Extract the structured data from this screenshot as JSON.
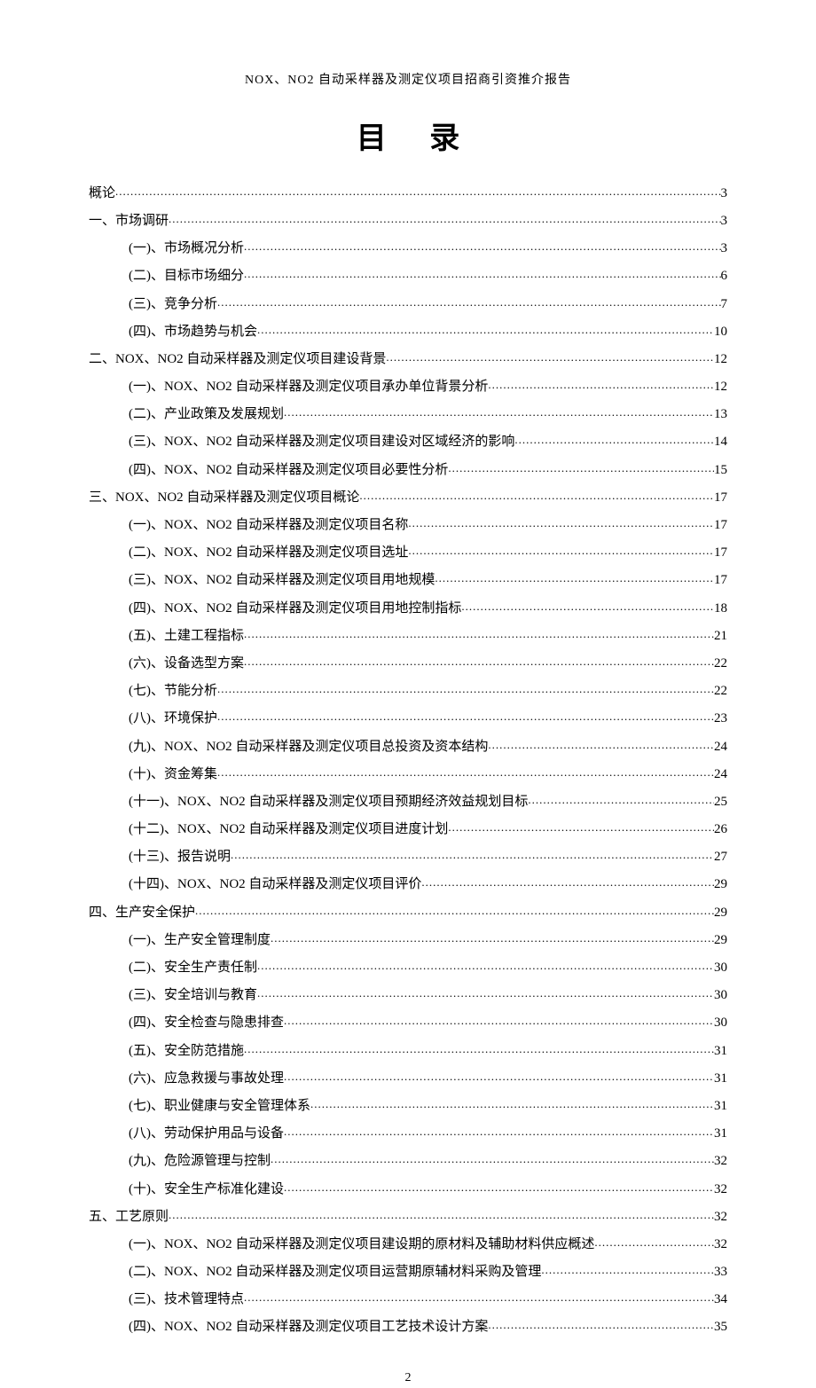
{
  "header": "NOX、NO2 自动采样器及测定仪项目招商引资推介报告",
  "title": "目 录",
  "page_number": "2",
  "toc": [
    {
      "indent": 0,
      "label": "概论",
      "page": "3"
    },
    {
      "indent": 0,
      "label": "一、市场调研",
      "page": "3"
    },
    {
      "indent": 1,
      "label": "(一)、市场概况分析",
      "page": "3"
    },
    {
      "indent": 1,
      "label": "(二)、目标市场细分",
      "page": "6"
    },
    {
      "indent": 1,
      "label": "(三)、竞争分析",
      "page": "7"
    },
    {
      "indent": 1,
      "label": "(四)、市场趋势与机会",
      "page": "10"
    },
    {
      "indent": 0,
      "label": "二、NOX、NO2 自动采样器及测定仪项目建设背景",
      "page": "12"
    },
    {
      "indent": 1,
      "label": "(一)、NOX、NO2 自动采样器及测定仪项目承办单位背景分析",
      "page": "12"
    },
    {
      "indent": 1,
      "label": "(二)、产业政策及发展规划",
      "page": "13"
    },
    {
      "indent": 1,
      "label": "(三)、NOX、NO2 自动采样器及测定仪项目建设对区域经济的影响",
      "page": "14"
    },
    {
      "indent": 1,
      "label": "(四)、NOX、NO2 自动采样器及测定仪项目必要性分析",
      "page": "15"
    },
    {
      "indent": 0,
      "label": "三、NOX、NO2 自动采样器及测定仪项目概论",
      "page": "17"
    },
    {
      "indent": 1,
      "label": "(一)、NOX、NO2 自动采样器及测定仪项目名称",
      "page": "17"
    },
    {
      "indent": 1,
      "label": "(二)、NOX、NO2 自动采样器及测定仪项目选址",
      "page": "17"
    },
    {
      "indent": 1,
      "label": "(三)、NOX、NO2 自动采样器及测定仪项目用地规模",
      "page": "17"
    },
    {
      "indent": 1,
      "label": "(四)、NOX、NO2 自动采样器及测定仪项目用地控制指标",
      "page": "18"
    },
    {
      "indent": 1,
      "label": "(五)、土建工程指标",
      "page": "21"
    },
    {
      "indent": 1,
      "label": "(六)、设备选型方案",
      "page": "22"
    },
    {
      "indent": 1,
      "label": "(七)、节能分析",
      "page": "22"
    },
    {
      "indent": 1,
      "label": "(八)、环境保护",
      "page": "23"
    },
    {
      "indent": 1,
      "label": "(九)、NOX、NO2 自动采样器及测定仪项目总投资及资本结构",
      "page": "24"
    },
    {
      "indent": 1,
      "label": "(十)、资金筹集",
      "page": "24"
    },
    {
      "indent": 1,
      "label": "(十一)、NOX、NO2 自动采样器及测定仪项目预期经济效益规划目标",
      "page": "25"
    },
    {
      "indent": 1,
      "label": "(十二)、NOX、NO2 自动采样器及测定仪项目进度计划",
      "page": "26"
    },
    {
      "indent": 1,
      "label": "(十三)、报告说明",
      "page": "27"
    },
    {
      "indent": 1,
      "label": "(十四)、NOX、NO2 自动采样器及测定仪项目评价",
      "page": "29"
    },
    {
      "indent": 0,
      "label": "四、生产安全保护",
      "page": "29"
    },
    {
      "indent": 1,
      "label": "(一)、生产安全管理制度",
      "page": "29"
    },
    {
      "indent": 1,
      "label": "(二)、安全生产责任制",
      "page": "30"
    },
    {
      "indent": 1,
      "label": "(三)、安全培训与教育",
      "page": "30"
    },
    {
      "indent": 1,
      "label": "(四)、安全检查与隐患排查",
      "page": "30"
    },
    {
      "indent": 1,
      "label": "(五)、安全防范措施",
      "page": "31"
    },
    {
      "indent": 1,
      "label": "(六)、应急救援与事故处理",
      "page": "31"
    },
    {
      "indent": 1,
      "label": "(七)、职业健康与安全管理体系",
      "page": "31"
    },
    {
      "indent": 1,
      "label": "(八)、劳动保护用品与设备",
      "page": "31"
    },
    {
      "indent": 1,
      "label": "(九)、危险源管理与控制",
      "page": "32"
    },
    {
      "indent": 1,
      "label": "(十)、安全生产标准化建设",
      "page": "32"
    },
    {
      "indent": 0,
      "label": "五、工艺原则",
      "page": "32"
    },
    {
      "indent": 1,
      "label": "(一)、NOX、NO2 自动采样器及测定仪项目建设期的原材料及辅助材料供应概述",
      "page": "32"
    },
    {
      "indent": 1,
      "label": "(二)、NOX、NO2 自动采样器及测定仪项目运营期原辅材料采购及管理",
      "page": "33"
    },
    {
      "indent": 1,
      "label": "(三)、技术管理特点",
      "page": "34"
    },
    {
      "indent": 1,
      "label": "(四)、NOX、NO2 自动采样器及测定仪项目工艺技术设计方案",
      "page": "35"
    }
  ]
}
